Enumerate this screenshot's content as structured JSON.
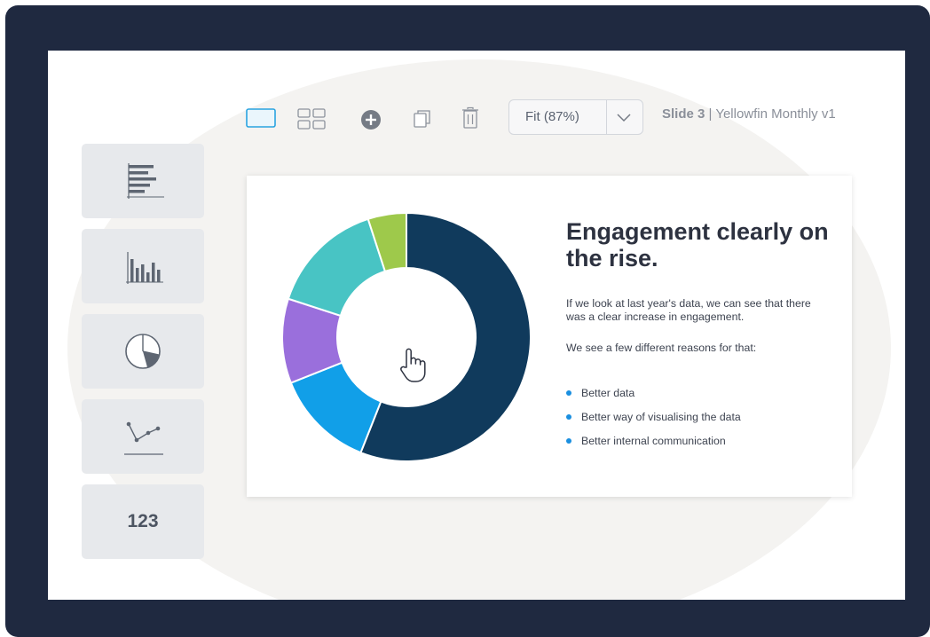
{
  "toolbar": {
    "icons": [
      "single-slide-view-icon",
      "grid-view-icon",
      "add-icon",
      "duplicate-icon",
      "trash-icon"
    ],
    "zoom_select": {
      "selected": "Fit (87%)"
    },
    "slide_number": "Slide 3",
    "presentation_name": "| Yellowfin Monthly v1"
  },
  "chart_types": [
    {
      "icon": "bar-chart-icon"
    },
    {
      "icon": "column-chart-icon"
    },
    {
      "icon": "pie-chart-icon"
    },
    {
      "icon": "line-chart-icon"
    },
    {
      "icon": "number-icon",
      "label": "123"
    }
  ],
  "slide": {
    "title": "Engagement clearly on the rise.",
    "paragraph_1": "If we look at last year's data, we can see that there was a clear increase in engagement.",
    "paragraph_2": "We see a few different reasons for that:",
    "bullets": [
      "Better data",
      "Better way of visualising the data",
      "Better internal communication"
    ]
  },
  "colors": {
    "accent": "#29a3e0",
    "frame": "#1f2940",
    "bullet": "#1a8fe0"
  },
  "chart_data": {
    "type": "pie",
    "slices": [
      {
        "value": 56,
        "color": "#103a5c"
      },
      {
        "value": 13,
        "color": "#119fe8"
      },
      {
        "value": 11,
        "color": "#9a6fdc"
      },
      {
        "value": 15,
        "color": "#48c4c4"
      },
      {
        "value": 5,
        "color": "#9ec94b"
      }
    ]
  }
}
